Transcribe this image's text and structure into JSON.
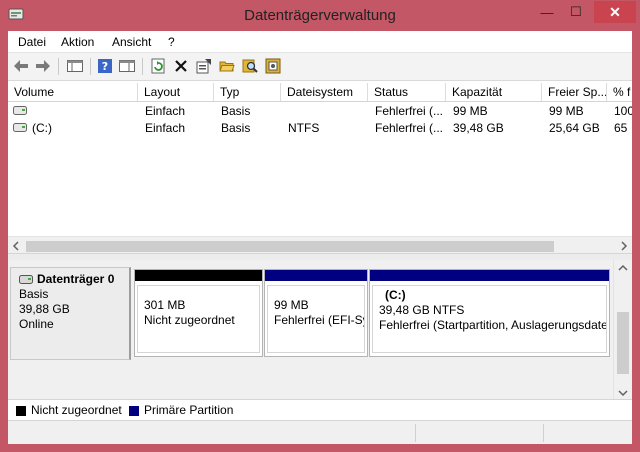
{
  "window": {
    "title": "Datenträgerverwaltung",
    "controls": {
      "minimize": "—",
      "maximize": "☐",
      "close": "✕"
    }
  },
  "menu": [
    "Datei",
    "Aktion",
    "Ansicht",
    "?"
  ],
  "toolbar": {
    "icons": [
      "back-arrow-icon",
      "forward-arrow-icon",
      "console-tree-icon",
      "help-icon",
      "properties-pane-icon",
      "refresh-icon",
      "delete-icon",
      "properties-icon",
      "open-folder-icon",
      "explore-icon",
      "disk-wizard-icon"
    ]
  },
  "volume_list": {
    "columns": [
      "Volume",
      "Layout",
      "Typ",
      "Dateisystem",
      "Status",
      "Kapazität",
      "Freier Sp...",
      "% f"
    ],
    "rows": [
      {
        "volume": "",
        "layout": "Einfach",
        "typ": "Basis",
        "dateisystem": "",
        "status": "Fehlerfrei (...",
        "kapazitaet": "99 MB",
        "frei": "99 MB",
        "prozent": "100"
      },
      {
        "volume": "(C:)",
        "layout": "Einfach",
        "typ": "Basis",
        "dateisystem": "NTFS",
        "status": "Fehlerfrei (...",
        "kapazitaet": "39,48 GB",
        "frei": "25,64 GB",
        "prozent": "65"
      }
    ]
  },
  "disk": {
    "name": "Datenträger 0",
    "type": "Basis",
    "size": "39,88 GB",
    "state": "Online",
    "partitions": [
      {
        "title": "",
        "size": "301 MB",
        "status": "Nicht zugeordnet",
        "color": "#000000"
      },
      {
        "title": "",
        "size": "99 MB",
        "status": "Fehlerfrei (EFI-Sy",
        "color": "#000080"
      },
      {
        "title": "(C:)",
        "size": "39,48 GB NTFS",
        "status": "Fehlerfrei (Startpartition, Auslagerungsdate",
        "color": "#000080"
      }
    ]
  },
  "legend": [
    {
      "label": "Nicht zugeordnet",
      "color": "#000000"
    },
    {
      "label": "Primäre Partition",
      "color": "#000080"
    }
  ],
  "colors": {
    "frame": "#c45765",
    "close": "#c9444e",
    "primary": "#000080",
    "unallocated": "#000000"
  }
}
